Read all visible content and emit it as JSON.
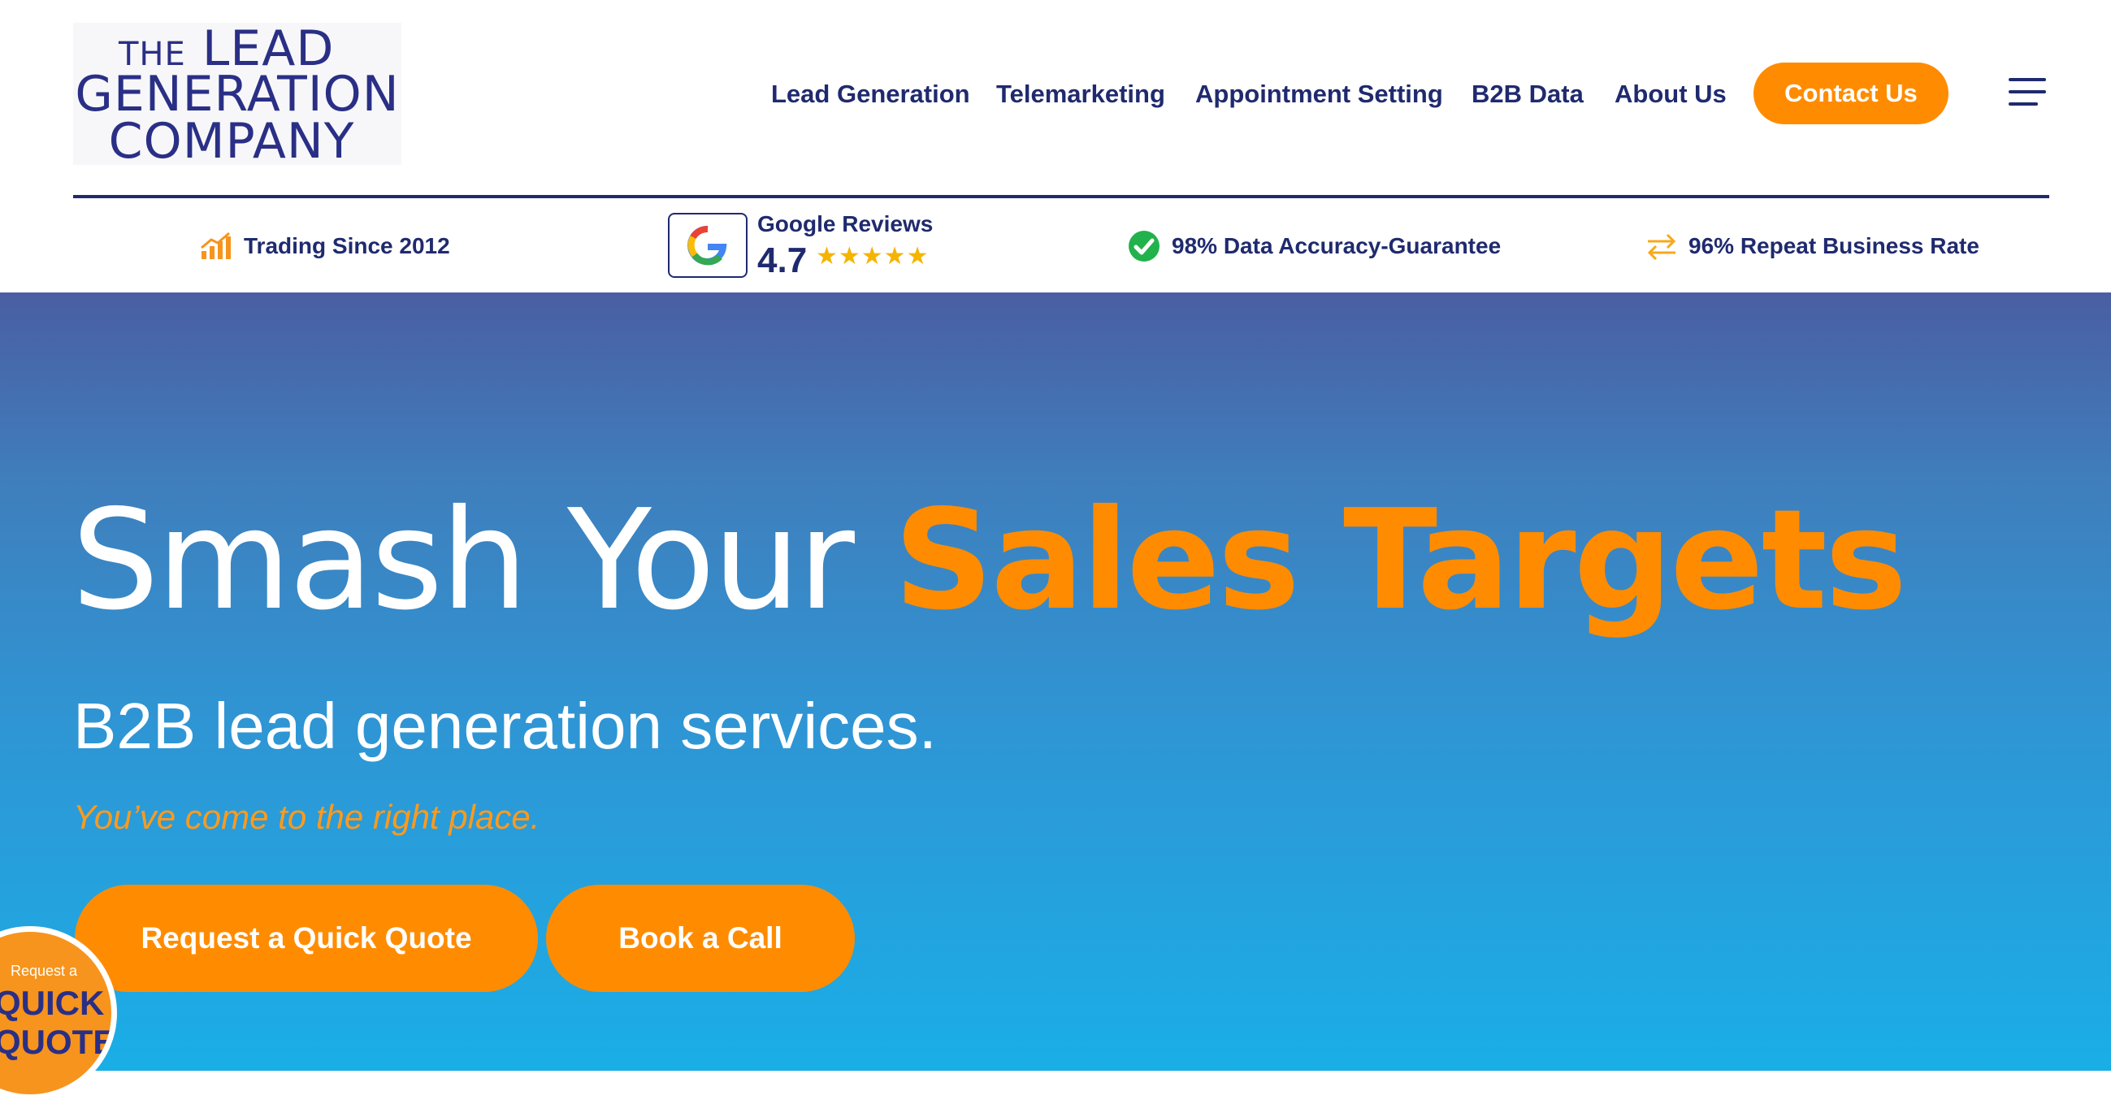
{
  "brand": {
    "logo_line1_small": "THE",
    "logo_line1": "LEAD",
    "logo_line2": "GENERATION",
    "logo_line3": "COMPANY"
  },
  "nav": {
    "items": [
      {
        "label": "Lead Generation"
      },
      {
        "label": "Telemarketing"
      },
      {
        "label": "Appointment Setting"
      },
      {
        "label": "B2B Data"
      },
      {
        "label": "About Us"
      }
    ],
    "contact_label": "Contact Us",
    "menu_icon": "hamburger-menu-icon"
  },
  "trust_bar": {
    "trading": "Trading Since 2012",
    "google_title": "Google Reviews",
    "google_rating": "4.7",
    "google_stars": "★★★★★",
    "accuracy": "98% Data Accuracy-Guarantee",
    "repeat": "96% Repeat Business Rate"
  },
  "hero": {
    "headline_plain": "Smash Your",
    "headline_accent": "Sales Targets",
    "subhead": "B2B lead generation services.",
    "tagline": "You’ve come to the right place.",
    "quote_button": "Request a Quick Quote",
    "call_button": "Book a Call"
  },
  "badge": {
    "small": "Request a",
    "line1": "QUICK",
    "line2": "QUOTE"
  },
  "colors": {
    "navy": "#1f2a6e",
    "orange": "#ff8c00",
    "hero_top": "#4a5ea3",
    "hero_bottom": "#1aaee7"
  }
}
